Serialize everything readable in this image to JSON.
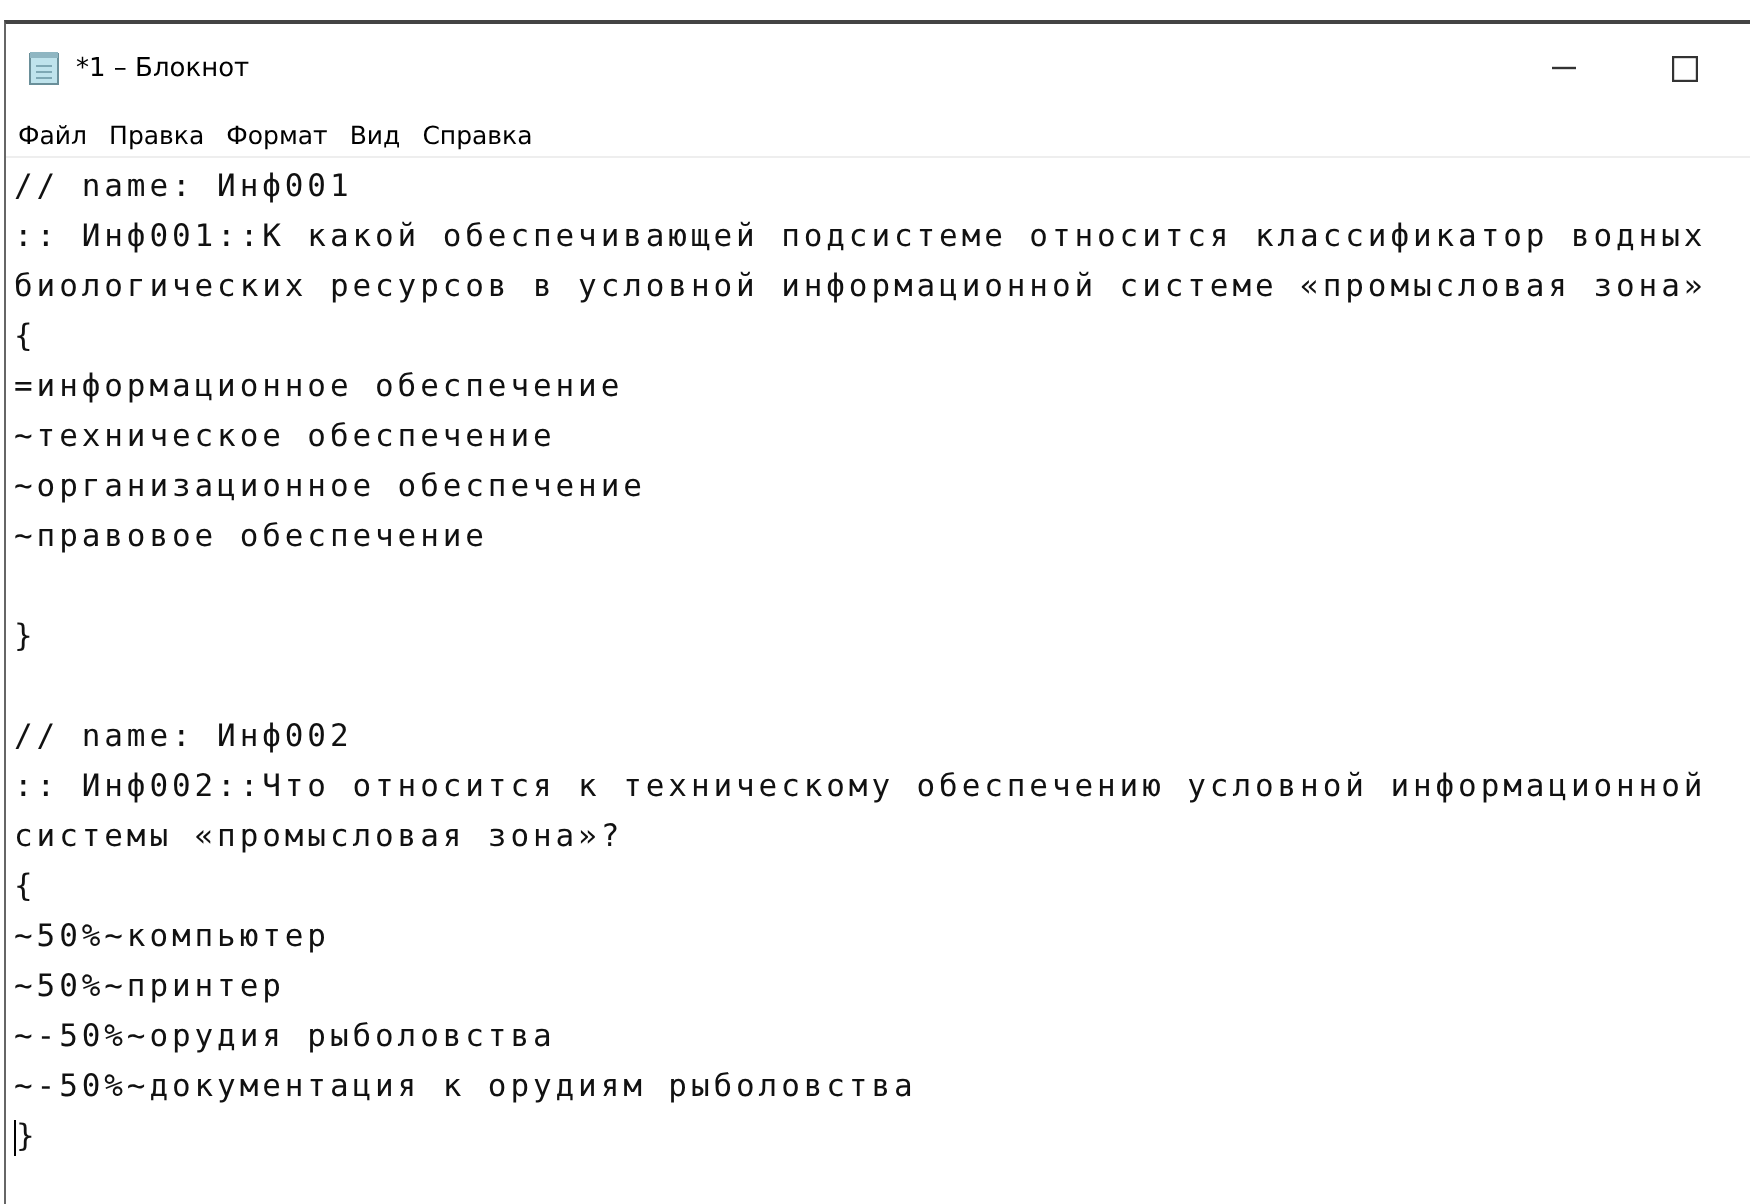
{
  "window": {
    "title": "*1 – Блокнот"
  },
  "menu": [
    "Файл",
    "Правка",
    "Формат",
    "Вид",
    "Справка"
  ],
  "editor": {
    "lines": [
      {
        "kind": "text",
        "text": "// name: Инф001"
      },
      {
        "kind": "text",
        "text": ":: Инф001::К какой обеспечивающей подсистеме относится классификатор водных"
      },
      {
        "kind": "text",
        "text": "биологических ресурсов в условной информационной системе «промысловая зона»"
      },
      {
        "kind": "text",
        "text": "{"
      },
      {
        "kind": "text",
        "text": "=информационное обеспечение"
      },
      {
        "kind": "text",
        "text": "~техническое обеспечение"
      },
      {
        "kind": "text",
        "text": "~организационное обеспечение"
      },
      {
        "kind": "text",
        "text": "~правовое обеспечение"
      },
      {
        "kind": "blank"
      },
      {
        "kind": "text",
        "text": "}"
      },
      {
        "kind": "blank"
      },
      {
        "kind": "text",
        "text": "// name: Инф002"
      },
      {
        "kind": "text",
        "text": ":: Инф002::Что относится к техническому обеспечению условной информационной"
      },
      {
        "kind": "text",
        "text": "системы «промысловая зона»?"
      },
      {
        "kind": "text",
        "text": "{"
      },
      {
        "kind": "text",
        "text": "~50%~компьютер"
      },
      {
        "kind": "text",
        "text": "~50%~принтер"
      },
      {
        "kind": "text",
        "text": "~-50%~орудия рыболовства"
      },
      {
        "kind": "text",
        "text": "~-50%~документация к орудиям рыболовства"
      },
      {
        "kind": "caret",
        "text": "}"
      }
    ]
  }
}
